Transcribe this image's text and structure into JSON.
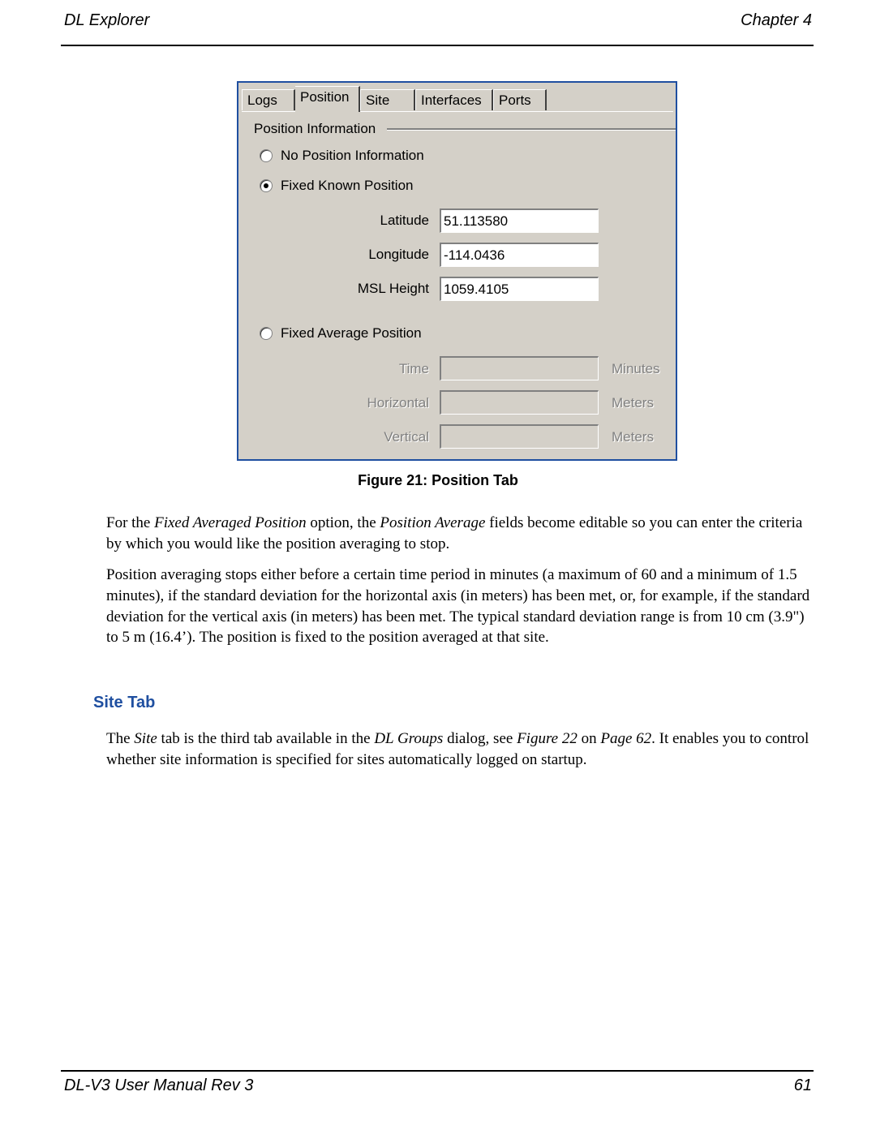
{
  "header": {
    "left": "DL Explorer",
    "right": "Chapter 4"
  },
  "dialog": {
    "tabs": [
      {
        "label": "Logs",
        "active": false
      },
      {
        "label": "Position",
        "active": true
      },
      {
        "label": "Site",
        "active": false
      },
      {
        "label": "Interfaces",
        "active": false
      },
      {
        "label": "Ports",
        "active": false
      }
    ],
    "group_label": "Position Information",
    "radios": [
      {
        "label": "No Position Information",
        "checked": false
      },
      {
        "label": "Fixed Known Position",
        "checked": true
      },
      {
        "label": "Fixed Average Position",
        "checked": false
      }
    ],
    "known_fields": [
      {
        "label": "Latitude",
        "value": "51.113580"
      },
      {
        "label": "Longitude",
        "value": "-114.0436"
      },
      {
        "label": "MSL Height",
        "value": "1059.4105"
      }
    ],
    "average_fields": [
      {
        "label": "Time",
        "value": "",
        "unit": "Minutes"
      },
      {
        "label": "Horizontal",
        "value": "",
        "unit": "Meters"
      },
      {
        "label": "Vertical",
        "value": "",
        "unit": "Meters"
      }
    ]
  },
  "caption": "Figure 21: Position Tab",
  "paragraph1": {
    "t1": "For the ",
    "i1": "Fixed Averaged Position",
    "t2": " option, the ",
    "i2": "Position Average",
    "t3": " fields become editable so you can enter the criteria by which you would like the position averaging to stop."
  },
  "paragraph2": "Position averaging stops either before a certain time period in minutes (a maximum of 60 and a minimum of 1.5 minutes), if the standard deviation for the horizontal axis (in meters) has been met, or, for example, if the standard deviation for the vertical axis (in meters) has been met. The typical standard deviation range is from 10 cm (3.9\") to 5 m (16.4’). The position is fixed to the position averaged at that site.",
  "section_heading": "Site Tab",
  "paragraph3": {
    "t1": "The ",
    "i1": "Site",
    "t2": " tab is the third tab available in the ",
    "i2": "DL Groups",
    "t3": " dialog, see ",
    "i3": "Figure 22",
    "t4": " on ",
    "i4": "Page 62",
    "t5": ". It enables you to control whether site information is specified for sites automatically logged on startup."
  },
  "footer": {
    "left": "DL-V3 User Manual Rev 3",
    "right": "61"
  }
}
